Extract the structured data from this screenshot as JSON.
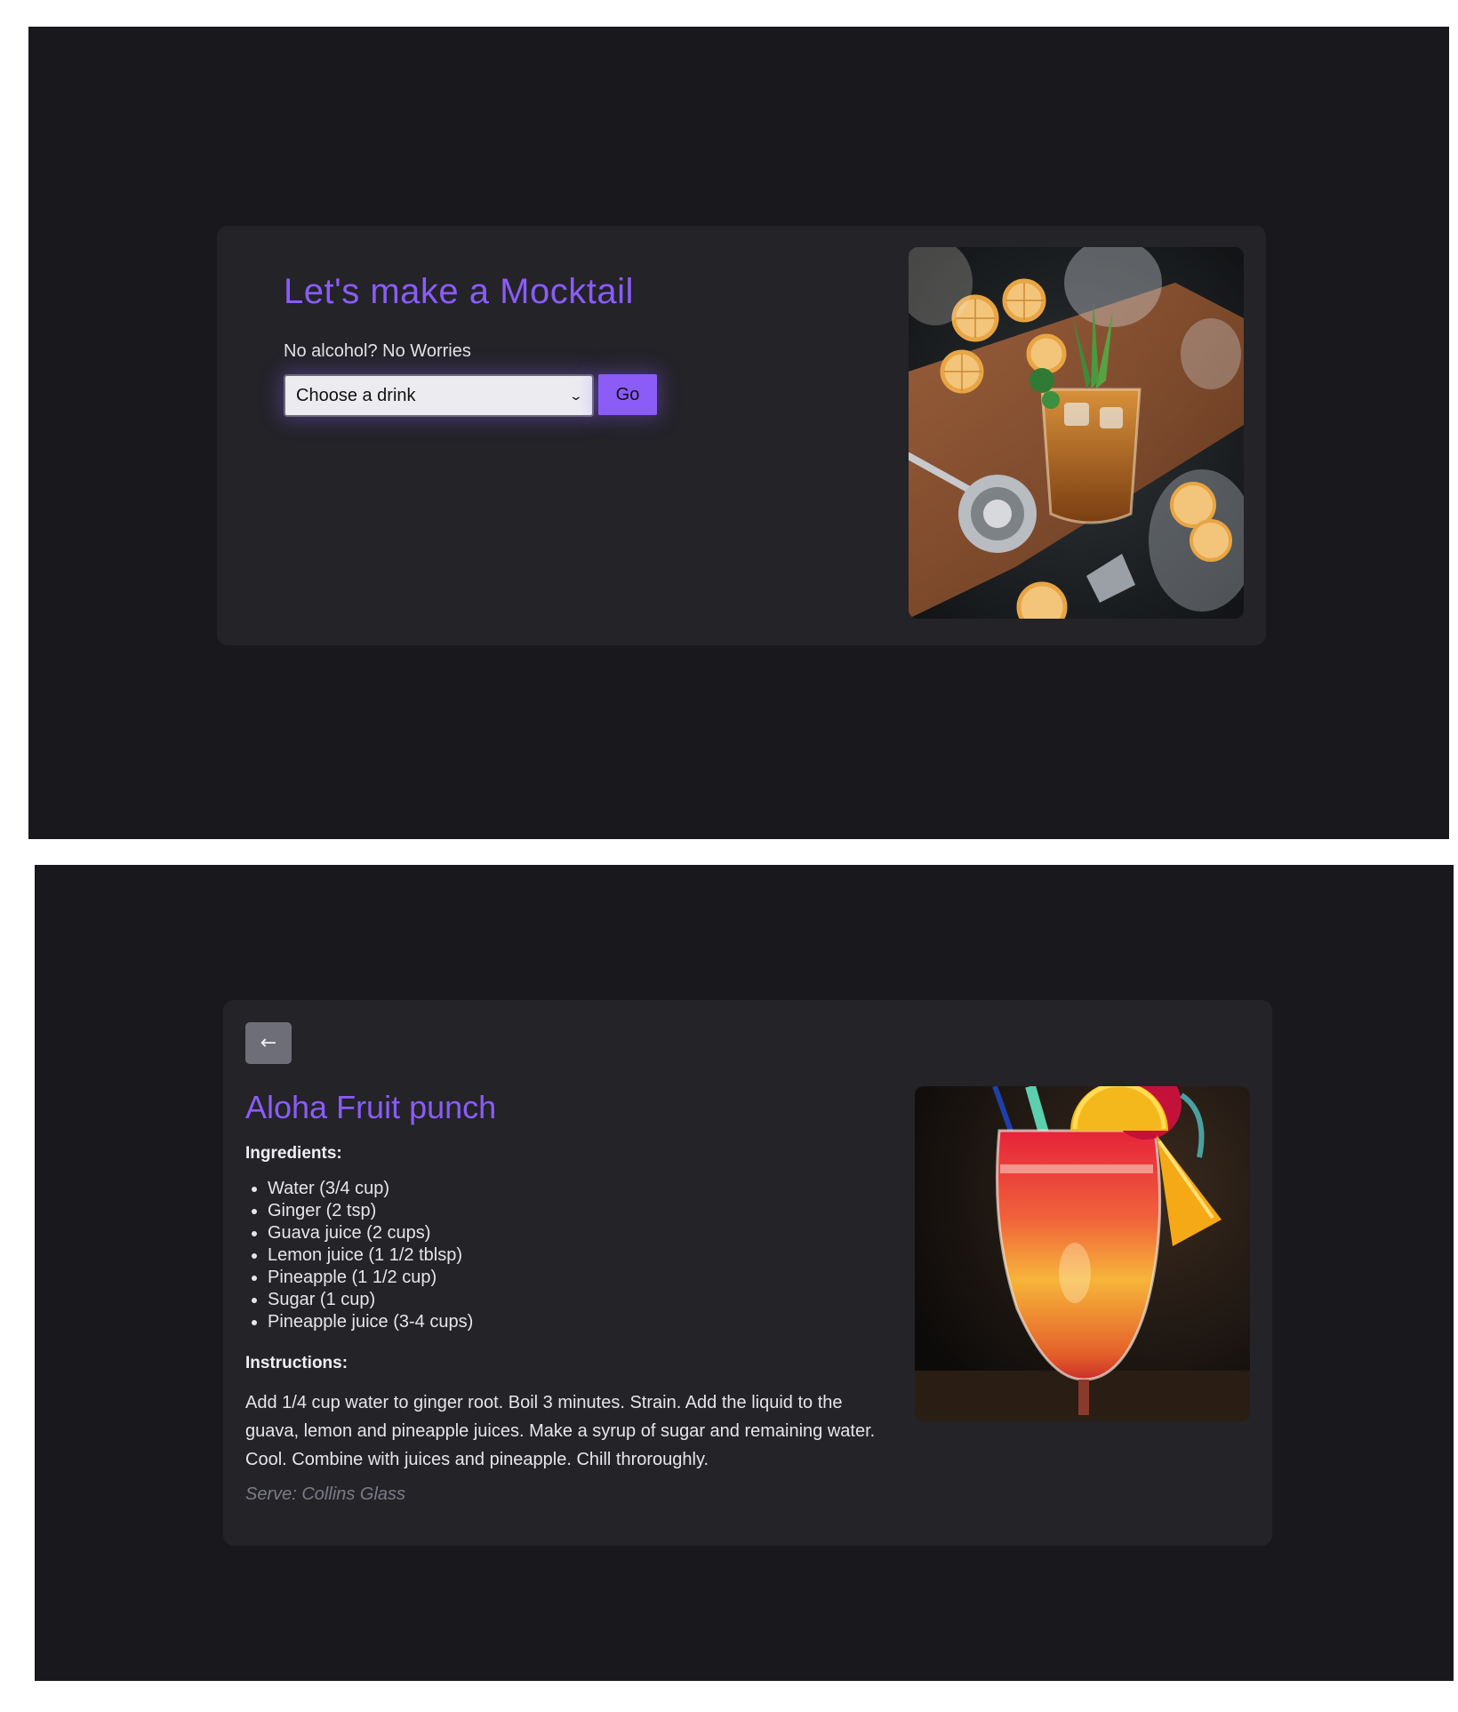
{
  "home": {
    "title": "Let's make a Mocktail",
    "subtitle": "No alcohol? No Worries",
    "select": {
      "selected": "Choose a drink"
    },
    "go_label": "Go",
    "photo_icon": "cocktail-bar-photo"
  },
  "detail": {
    "back_label": "←",
    "title": "Aloha Fruit punch",
    "ingredients_label": "Ingredients:",
    "ingredients": [
      "Water (3/4 cup)",
      "Ginger (2 tsp)",
      "Guava juice (2 cups)",
      "Lemon juice (1 1/2 tblsp)",
      "Pineapple (1 1/2 cup)",
      "Sugar (1 cup)",
      "Pineapple juice (3-4 cups)"
    ],
    "instructions_label": "Instructions:",
    "instructions": "Add 1/4 cup water to ginger root. Boil 3 minutes. Strain. Add the liquid to the guava, lemon and pineapple juices. Make a syrup of sugar and remaining water. Cool. Combine with juices and pineapple. Chill throroughly.",
    "serve": "Serve: Collins Glass",
    "photo_icon": "fruit-punch-glass-photo"
  },
  "colors": {
    "page_bg": "#18181d",
    "card_bg": "#232328",
    "accent": "#8b5cf6",
    "muted": "#7c7c86"
  }
}
